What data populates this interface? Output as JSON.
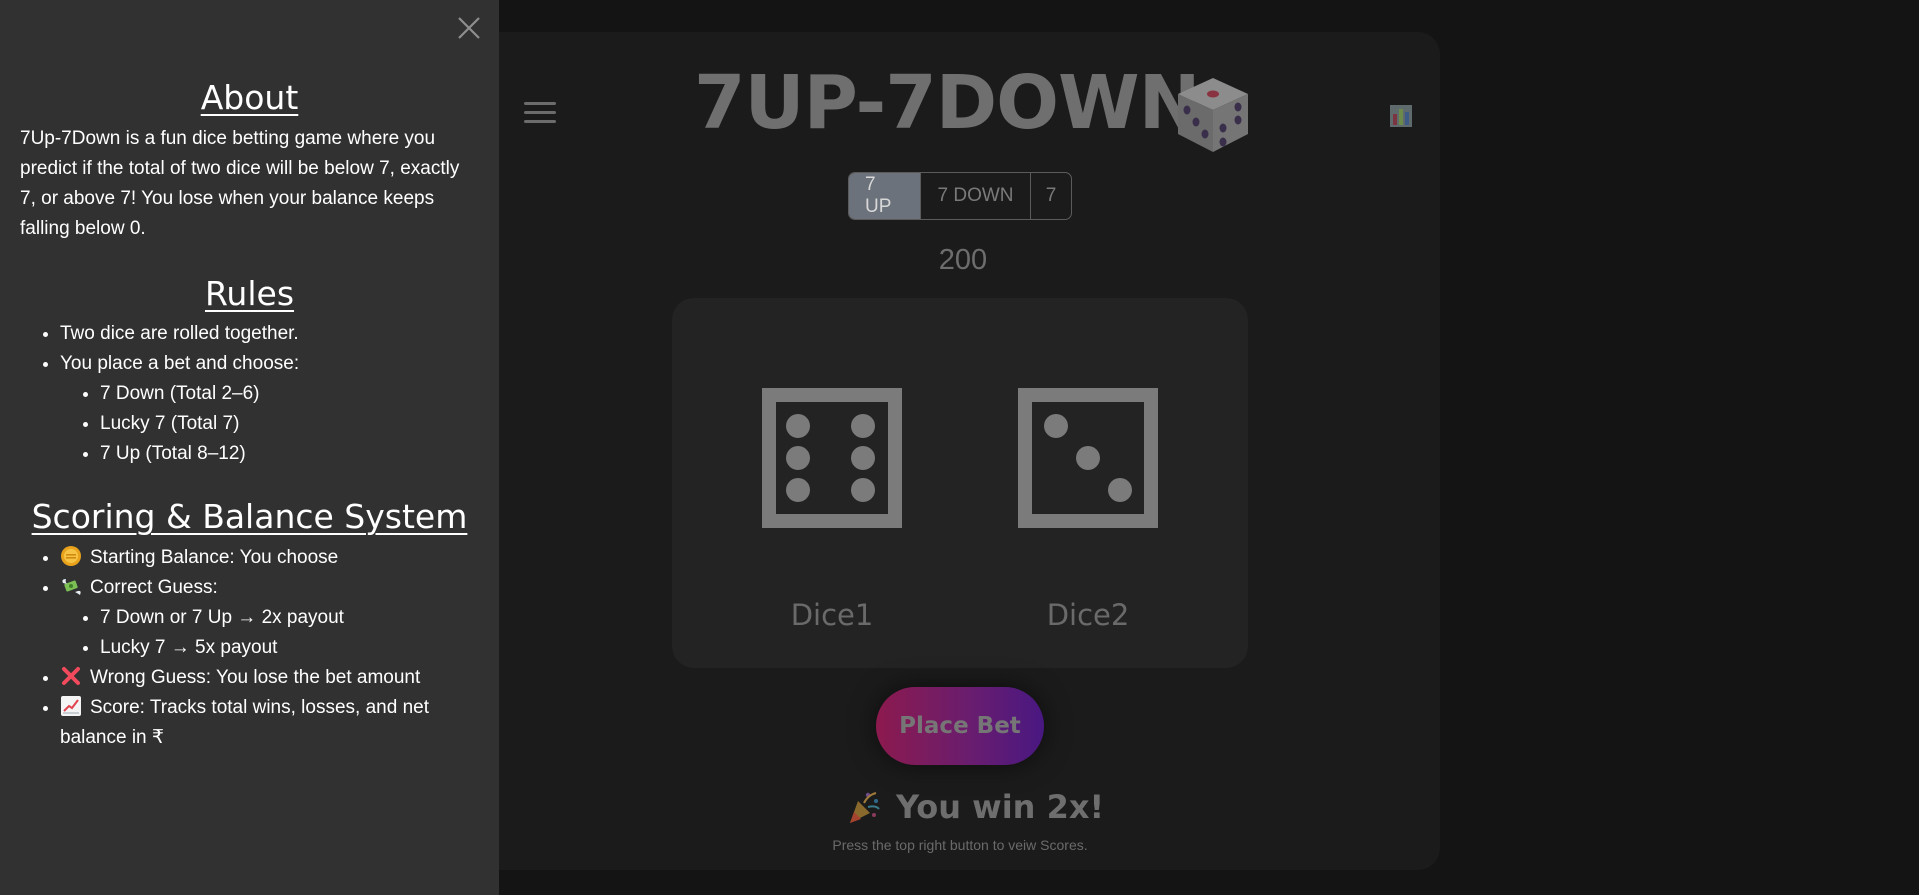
{
  "game": {
    "title": "7UP-7DOWN",
    "options": [
      {
        "label": "7 UP",
        "active": true
      },
      {
        "label": "7 DOWN",
        "active": false
      },
      {
        "label": "7",
        "active": false
      }
    ],
    "balance": "200",
    "dice": [
      {
        "label": "Dice1",
        "value": 6
      },
      {
        "label": "Dice2",
        "value": 3
      }
    ],
    "place_bet_label": "Place Bet",
    "result_text": "You win 2x!",
    "hint_text": "Press the top right button to veiw Scores."
  },
  "sidebar": {
    "about_heading": "About",
    "about_text": "7Up-7Down is a fun dice betting game where you predict if the total of two dice will be below 7, exactly 7, or above 7! You lose when your balance keeps falling below 0.",
    "rules_heading": "Rules",
    "rules": {
      "item1": "Two dice are rolled together.",
      "item2": "You place a bet and choose:",
      "sub": [
        "7 Down (Total 2–6)",
        "Lucky 7 (Total 7)",
        "7 Up (Total 8–12)"
      ]
    },
    "scoring_heading": "Scoring & Balance System",
    "scoring": {
      "starting": "Starting Balance: You choose",
      "correct": "Correct Guess:",
      "correct_sub": [
        "7 Down or 7 Up → 2x payout",
        "Lucky 7 → 5x payout"
      ],
      "wrong": "Wrong Guess: You lose the bet amount",
      "score": "Score: Tracks total wins, losses, and net balance in ₹"
    }
  },
  "icons": {
    "menu": "hamburger-menu-icon",
    "dice_logo": "game-die-icon",
    "scores": "bar-chart-icon",
    "close": "close-icon",
    "party": "party-popper-icon",
    "coin": "coin-icon",
    "money": "money-with-wings-icon",
    "cross": "cross-mark-icon",
    "chart": "chart-increasing-icon"
  },
  "colors": {
    "sidebar_bg": "#313131",
    "page_bg": "#141414",
    "card_bg": "#1b1b1b",
    "board_bg": "#232323",
    "active_option_bg": "#6b727b",
    "button_gradient_start": "#8c1a4e",
    "button_gradient_end": "#491882"
  }
}
